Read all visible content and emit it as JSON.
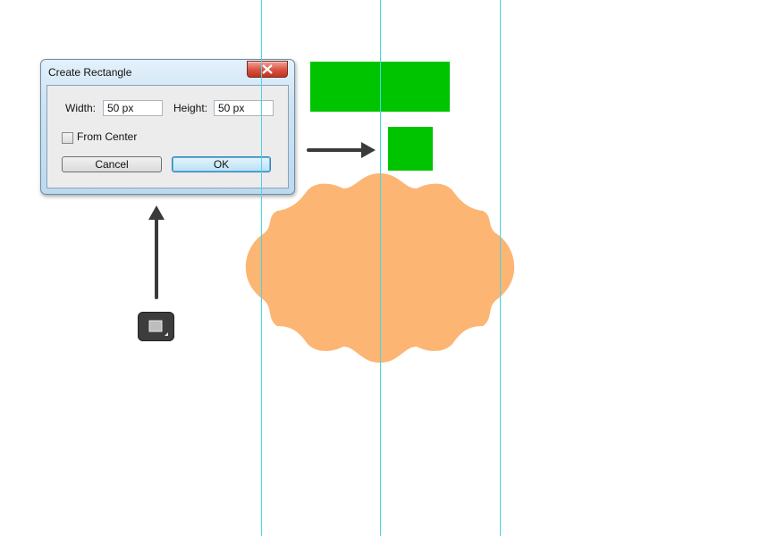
{
  "dialog": {
    "title": "Create Rectangle",
    "width_label": "Width:",
    "width_value": "50 px",
    "height_label": "Height:",
    "height_value": "50 px",
    "from_center_label": "From Center",
    "from_center_checked": false,
    "cancel_label": "Cancel",
    "ok_label": "OK"
  },
  "canvas": {
    "background": "#ffffff",
    "guide_color": "#45d6e8",
    "rectangle_color": "#00c400",
    "label_shape_color": "#fdb574",
    "arrow_color": "#3a3a3a"
  },
  "icons": {
    "close": "close-x-icon",
    "tool": "rectangle-tool-icon",
    "arrow_up": "arrow-up-icon",
    "arrow_right": "arrow-right-icon"
  }
}
